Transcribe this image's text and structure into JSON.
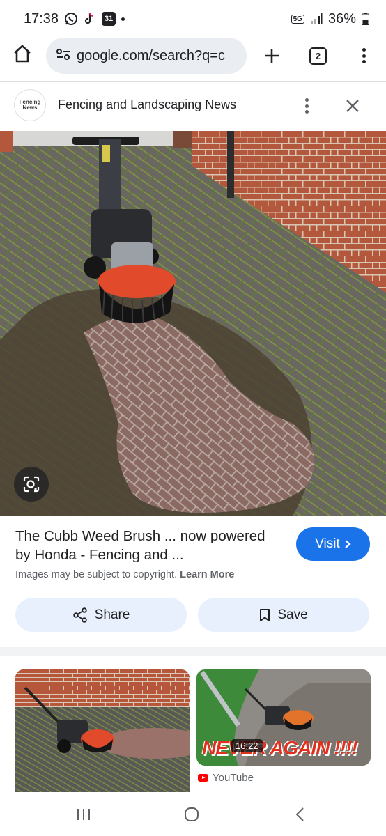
{
  "status_bar": {
    "time": "17:38",
    "calendar_day": "31",
    "network": "5G",
    "battery": "36%",
    "icons": [
      "whatsapp-icon",
      "tiktok-icon",
      "calendar-icon",
      "signal-icon",
      "battery-icon"
    ]
  },
  "browser": {
    "url": "google.com/search?q=c",
    "tab_count": "2"
  },
  "panel": {
    "source_logo_text": "Fencing News",
    "source_name": "Fencing and Landscaping News"
  },
  "result": {
    "title": "The Cubb Weed Brush ... now powered by Honda - Fencing and ...",
    "visit_label": "Visit",
    "copyright_text": "Images may be subject to copyright.",
    "learn_more": "Learn More",
    "share_label": "Share",
    "save_label": "Save"
  },
  "related": {
    "video_duration": "16:22",
    "video_overlay_text": "NEVER AGAIN !!!!",
    "video_source": "YouTube"
  },
  "colors": {
    "accent": "#1a73e8",
    "pill_bg": "#e8f0fe",
    "url_bg": "#eaeef3",
    "youtube_red": "#ff0000"
  }
}
